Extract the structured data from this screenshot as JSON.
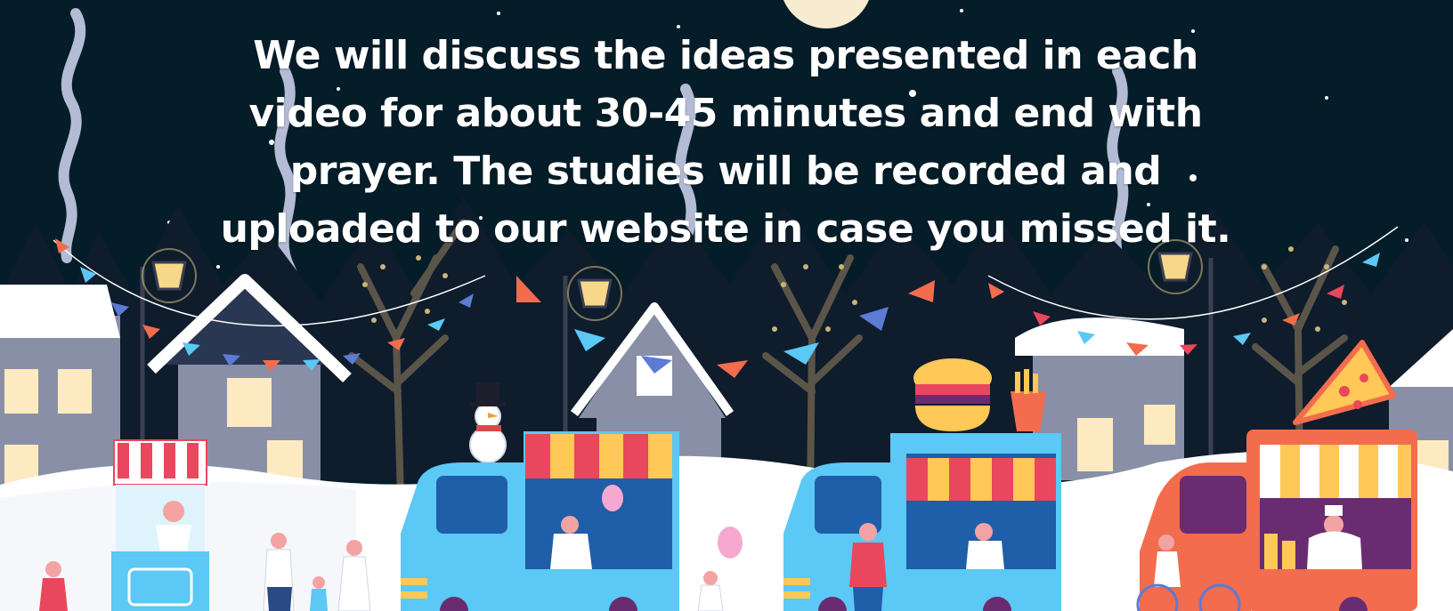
{
  "caption": {
    "text": "We will discuss the ideas presented in each video for about 30-45 minutes and end with prayer. The studies will be recorded and uploaded to our website in case you missed it."
  },
  "scene": {
    "background_color": "#051d29",
    "snow_color": "#ffffff",
    "accent_colors": [
      "#5bc8f5",
      "#f36c4e",
      "#ffc857",
      "#e9475d",
      "#6a2c70"
    ]
  }
}
